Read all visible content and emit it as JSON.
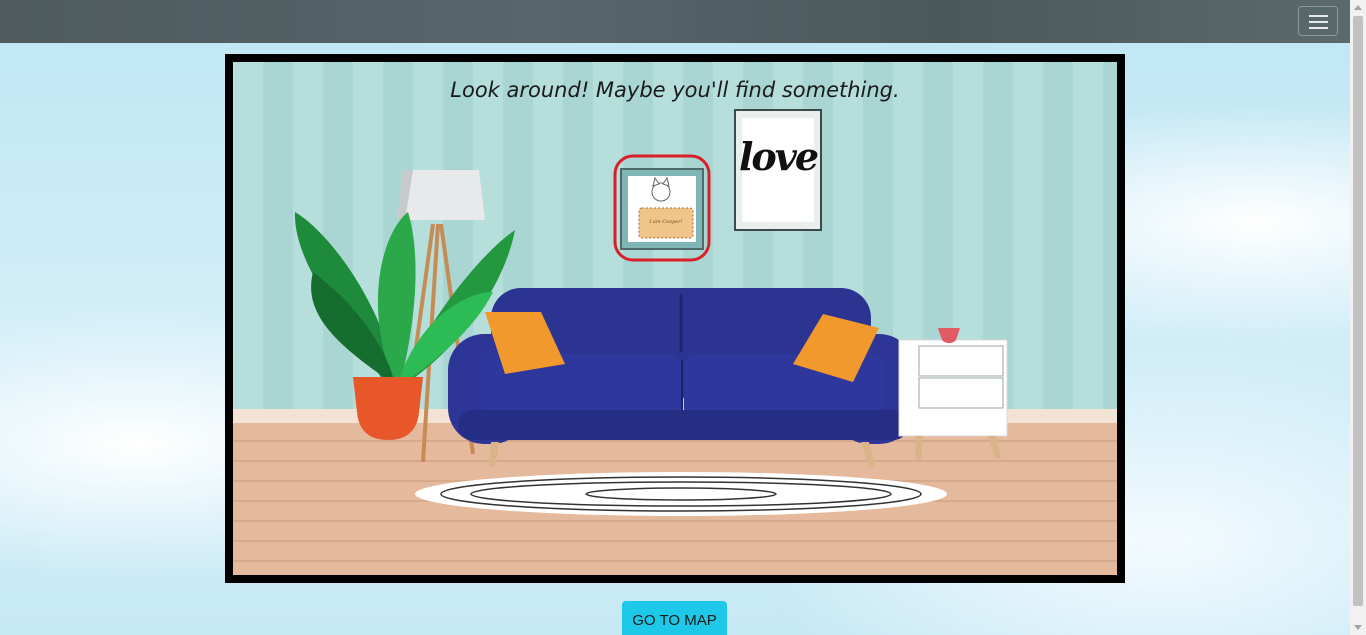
{
  "navbar": {
    "toggler_icon": "hamburger-menu-icon"
  },
  "scene": {
    "caption": "Look around! Maybe you'll find something.",
    "framed_dog_sign": "I am Cooper!",
    "poster_text": "love"
  },
  "actions": {
    "go_to_map": "GO TO MAP"
  },
  "colors": {
    "accent": "#1ec8e8",
    "sofa": "#2c3591",
    "highlight": "#d9202a"
  }
}
